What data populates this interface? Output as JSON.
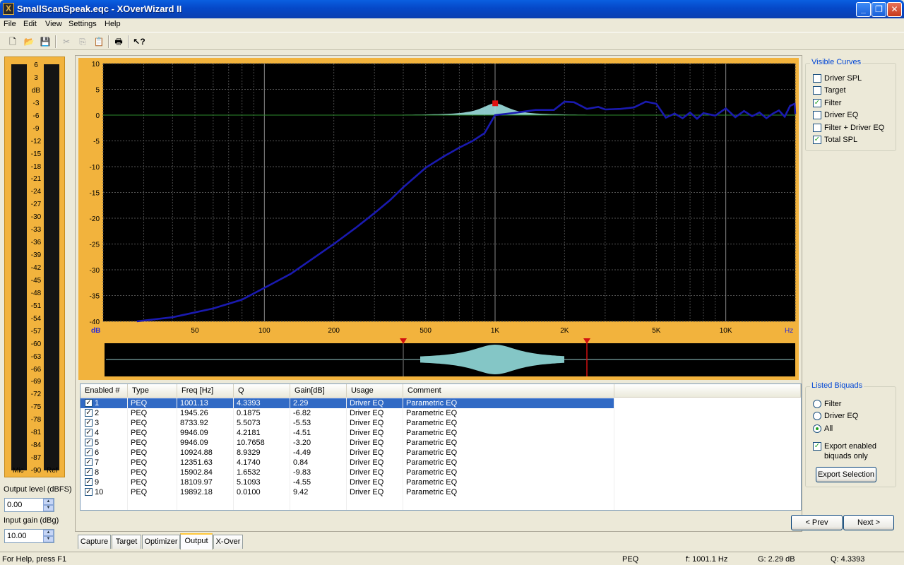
{
  "window": {
    "title": "SmallScanSpeak.eqc - XOverWizard II",
    "icon": "X",
    "buttons": [
      "minimize-icon",
      "restore-icon",
      "close-icon"
    ]
  },
  "menu": [
    "File",
    "Edit",
    "View",
    "Settings",
    "Help"
  ],
  "toolbar": {
    "icons": [
      "new-icon",
      "open-icon",
      "save-icon",
      "cut-icon",
      "copy-icon",
      "paste-icon",
      "print-icon",
      "help-cursor-icon"
    ]
  },
  "meter": {
    "ticks": [
      "6",
      "3",
      "dB",
      "-3",
      "-6",
      "-9",
      "-12",
      "-15",
      "-18",
      "-21",
      "-24",
      "-27",
      "-30",
      "-33",
      "-36",
      "-39",
      "-42",
      "-45",
      "-48",
      "-51",
      "-54",
      "-57",
      "-60",
      "-63",
      "-66",
      "-69",
      "-72",
      "-75",
      "-78",
      "-81",
      "-84",
      "-87",
      "-90"
    ],
    "mic_label": "Mic",
    "ref_label": "Ref",
    "colors": {
      "panel": "#f2b33d",
      "bar": "#141414"
    }
  },
  "output_level": {
    "label": "Output level (dBFS)",
    "value": "0.00"
  },
  "input_gain": {
    "label": "Input gain (dBg)",
    "value": "10.00"
  },
  "chart_data": {
    "type": "line",
    "y_unit_label": "dB",
    "x_unit_label": "Hz",
    "ylim": [
      -40,
      10
    ],
    "y_ticks": [
      10,
      5,
      0,
      -5,
      -10,
      -15,
      -20,
      -25,
      -30,
      -35,
      -40
    ],
    "x_scale": "log",
    "xlim": [
      20,
      20000
    ],
    "x_ticks": [
      {
        "label": "50",
        "value": 50
      },
      {
        "label": "100",
        "value": 100
      },
      {
        "label": "200",
        "value": 200
      },
      {
        "label": "500",
        "value": 500
      },
      {
        "label": "1K",
        "value": 1000
      },
      {
        "label": "2K",
        "value": 2000
      },
      {
        "label": "5K",
        "value": 5000
      },
      {
        "label": "10K",
        "value": 10000
      }
    ],
    "grid": true,
    "series": [
      {
        "color": "#1a1ab0",
        "points": [
          [
            28,
            -40
          ],
          [
            40,
            -39.2
          ],
          [
            60,
            -37.5
          ],
          [
            80,
            -35.8
          ],
          [
            100,
            -33.5
          ],
          [
            130,
            -30.8
          ],
          [
            160,
            -28
          ],
          [
            200,
            -25
          ],
          [
            250,
            -21.8
          ],
          [
            300,
            -19
          ],
          [
            350,
            -16.5
          ],
          [
            400,
            -14
          ],
          [
            450,
            -12
          ],
          [
            500,
            -10.2
          ],
          [
            600,
            -8
          ],
          [
            700,
            -6.3
          ],
          [
            800,
            -5
          ],
          [
            900,
            -3.5
          ],
          [
            1000,
            0
          ],
          [
            1200,
            0.4
          ],
          [
            1500,
            1
          ],
          [
            1800,
            1
          ],
          [
            2000,
            2.6
          ],
          [
            2200,
            2.5
          ],
          [
            2500,
            1.2
          ],
          [
            2800,
            1.6
          ],
          [
            3000,
            1.1
          ],
          [
            3500,
            1.2
          ],
          [
            4000,
            1.5
          ],
          [
            4500,
            2.6
          ],
          [
            5000,
            2.2
          ],
          [
            5500,
            -0.5
          ],
          [
            6000,
            0.3
          ],
          [
            6500,
            -0.6
          ],
          [
            7000,
            0.5
          ],
          [
            7500,
            -0.7
          ],
          [
            8000,
            0.4
          ],
          [
            9000,
            -0.1
          ],
          [
            10000,
            1.3
          ],
          [
            11000,
            -0.4
          ],
          [
            12000,
            0.8
          ],
          [
            13000,
            -0.2
          ],
          [
            14000,
            0.5
          ],
          [
            15000,
            -0.6
          ],
          [
            16000,
            0.3
          ],
          [
            17000,
            0.9
          ],
          [
            18000,
            -0.3
          ],
          [
            19000,
            1.8
          ],
          [
            19892,
            2.2
          ],
          [
            20000,
            0.2
          ]
        ]
      }
    ],
    "filter_peak": {
      "freq": 1001.13,
      "gain": 2.29,
      "color": "#9fe0e0"
    },
    "marker": {
      "freq": 1001.13,
      "gain": 2.29,
      "color": "#e01010"
    },
    "range_markers": {
      "low_freq": 400,
      "high_freq": 2500
    }
  },
  "table": {
    "columns": [
      "Enabled #",
      "Type",
      "Freq [Hz]",
      "Q",
      "Gain[dB]",
      "Usage",
      "Comment"
    ],
    "rows": [
      {
        "n": "1",
        "type": "PEQ",
        "freq": "1001.13",
        "q": "4.3393",
        "gain": "2.29",
        "usage": "Driver EQ",
        "comment": "Parametric EQ",
        "enabled": true,
        "selected": true
      },
      {
        "n": "2",
        "type": "PEQ",
        "freq": "1945.26",
        "q": "0.1875",
        "gain": "-6.82",
        "usage": "Driver EQ",
        "comment": "Parametric EQ",
        "enabled": true
      },
      {
        "n": "3",
        "type": "PEQ",
        "freq": "8733.92",
        "q": "5.5073",
        "gain": "-5.53",
        "usage": "Driver EQ",
        "comment": "Parametric EQ",
        "enabled": true
      },
      {
        "n": "4",
        "type": "PEQ",
        "freq": "9946.09",
        "q": "4.2181",
        "gain": "-4.51",
        "usage": "Driver EQ",
        "comment": "Parametric EQ",
        "enabled": true
      },
      {
        "n": "5",
        "type": "PEQ",
        "freq": "9946.09",
        "q": "10.7658",
        "gain": "-3.20",
        "usage": "Driver EQ",
        "comment": "Parametric EQ",
        "enabled": true
      },
      {
        "n": "6",
        "type": "PEQ",
        "freq": "10924.88",
        "q": "8.9329",
        "gain": "-4.49",
        "usage": "Driver EQ",
        "comment": "Parametric EQ",
        "enabled": true
      },
      {
        "n": "7",
        "type": "PEQ",
        "freq": "12351.63",
        "q": "4.1740",
        "gain": "0.84",
        "usage": "Driver EQ",
        "comment": "Parametric EQ",
        "enabled": true
      },
      {
        "n": "8",
        "type": "PEQ",
        "freq": "15902.84",
        "q": "1.6532",
        "gain": "-9.83",
        "usage": "Driver EQ",
        "comment": "Parametric EQ",
        "enabled": true
      },
      {
        "n": "9",
        "type": "PEQ",
        "freq": "18109.97",
        "q": "5.1093",
        "gain": "-4.55",
        "usage": "Driver EQ",
        "comment": "Parametric EQ",
        "enabled": true
      },
      {
        "n": "10",
        "type": "PEQ",
        "freq": "19892.18",
        "q": "0.0100",
        "gain": "9.42",
        "usage": "Driver EQ",
        "comment": "Parametric EQ",
        "enabled": true
      }
    ]
  },
  "visible_curves": {
    "title": "Visible Curves",
    "items": [
      {
        "label": "Driver SPL",
        "checked": false
      },
      {
        "label": "Target",
        "checked": false
      },
      {
        "label": "Filter",
        "checked": true
      },
      {
        "label": "Driver EQ",
        "checked": false
      },
      {
        "label": "Filter + Driver EQ",
        "checked": false
      },
      {
        "label": "Total SPL",
        "checked": true
      }
    ]
  },
  "listed_biquads": {
    "title": "Listed Biquads",
    "options": [
      {
        "label": "Filter",
        "selected": false
      },
      {
        "label": "Driver EQ",
        "selected": false
      },
      {
        "label": "All",
        "selected": true
      }
    ],
    "export_enabled_label_1": "Export enabled",
    "export_enabled_label_2": "biquads only",
    "export_enabled_checked": true,
    "export_button": "Export Selection"
  },
  "nav": {
    "prev": "< Prev",
    "next": "Next >"
  },
  "tabs": [
    {
      "label": "Capture",
      "active": false
    },
    {
      "label": "Target",
      "active": false
    },
    {
      "label": "Optimizer",
      "active": false
    },
    {
      "label": "Output",
      "active": true
    },
    {
      "label": "X-Over",
      "active": false
    }
  ],
  "status": {
    "help": "For Help, press F1",
    "type": "PEQ",
    "freq": "f: 1001.1 Hz",
    "gain": "G: 2.29 dB",
    "q": "Q: 4.3393"
  }
}
